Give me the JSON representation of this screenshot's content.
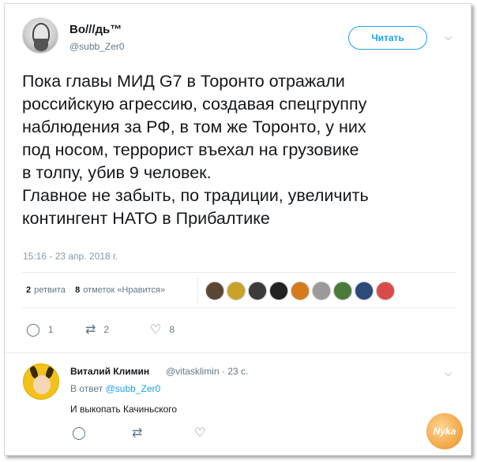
{
  "tweet": {
    "author": {
      "display_name": "Во///дь™",
      "handle": "@subb_Zer0"
    },
    "follow_label": "Читать",
    "text": "Пока главы МИД G7 в Торонто отражали\nроссийскую агрессию, создавая спецгруппу\nнаблюдения за РФ, в том же Торонто, у них\nпод носом, террорист въехал на грузовике\nв толпу, убив 9 человек.\nГлавное не забыть, по традиции, увеличить\nконтингент НАТО в Прибалтике",
    "timestamp": "15:16 - 23 апр. 2018 г.",
    "stats": {
      "retweets_count": "2",
      "retweets_label": "ретвита",
      "likes_count": "8",
      "likes_label": "отметок «Нравится»"
    },
    "liker_colors": [
      "#5b4636",
      "#c9a227",
      "#3b3b3b",
      "#222222",
      "#d77a1e",
      "#9a9a9a",
      "#4a7b3a",
      "#2c4a7a",
      "#d94b4b"
    ],
    "actions": {
      "reply_count": "1",
      "retweet_count": "2",
      "like_count": "8"
    }
  },
  "reply": {
    "author": {
      "display_name": "Виталий Климин",
      "handle": "@vitasklimin · 23 с."
    },
    "in_reply_prefix": "В ответ",
    "in_reply_handle": "@subb_Zer0",
    "text": "И выкопать Качиньского"
  },
  "icons": {
    "chevron": "⌵",
    "reply": "◯",
    "retweet": "⇄",
    "like": "♡"
  },
  "watermark": "Nyka"
}
